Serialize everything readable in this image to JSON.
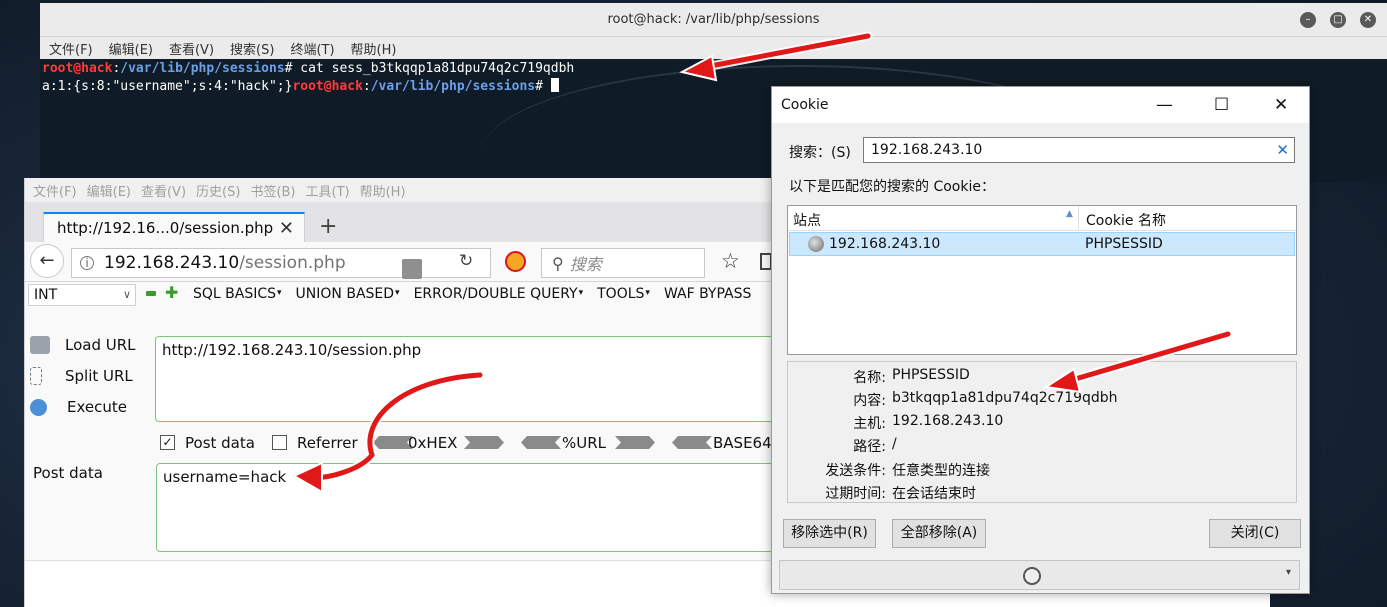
{
  "terminal": {
    "title": "root@hack: /var/lib/php/sessions",
    "menu": [
      "文件(F)",
      "编辑(E)",
      "查看(V)",
      "搜索(S)",
      "终端(T)",
      "帮助(H)"
    ],
    "line1": {
      "user": "root@hack",
      "sep": ":",
      "path": "/var/lib/php/sessions",
      "cmd": "# cat sess_b3tkqqp1a81dpu74q2c719qdbh"
    },
    "line2": {
      "output": "a:1:{s:8:\"username\";s:4:\"hack\";}",
      "user": "root@hack",
      "sep": ":",
      "path": "/var/lib/php/sessions",
      "prompt": "# "
    }
  },
  "firefox": {
    "menu": [
      "文件(F)",
      "编辑(E)",
      "查看(V)",
      "历史(S)",
      "书签(B)",
      "工具(T)",
      "帮助(H)"
    ],
    "tab_title": "http://192.16...0/session.php",
    "url_host": "192.168.243.10",
    "url_path": "/session.php",
    "search_placeholder": "搜索"
  },
  "hackbar": {
    "select_value": "INT",
    "menus": [
      "SQL BASICS",
      "UNION BASED",
      "ERROR/DOUBLE QUERY",
      "TOOLS",
      "WAF BYPASS"
    ],
    "load_url": "Load URL",
    "split_url": "Split URL",
    "execute": "Execute",
    "url_value": "http://192.168.243.10/session.php",
    "post_data_checked": true,
    "post_data_label": "Post data",
    "referrer_checked": false,
    "referrer_label": "Referrer",
    "hex_label": "0xHEX",
    "url_enc_label": "%URL",
    "base64_label": "BASE64",
    "post_section_label": "Post data",
    "post_value": "username=hack"
  },
  "cookie_dialog": {
    "title": "Cookie",
    "search_label": "搜索：(S)",
    "search_value": "192.168.243.10",
    "match_label": "以下是匹配您的搜索的 Cookie：",
    "col_site": "站点",
    "col_name": "Cookie 名称",
    "row_site": "192.168.243.10",
    "row_name": "PHPSESSID",
    "details": [
      {
        "label": "名称:",
        "value": "PHPSESSID"
      },
      {
        "label": "内容:",
        "value": "b3tkqqp1a81dpu74q2c719qdbh"
      },
      {
        "label": "主机:",
        "value": "192.168.243.10"
      },
      {
        "label": "路径:",
        "value": "/"
      },
      {
        "label": "发送条件:",
        "value": "任意类型的连接"
      },
      {
        "label": "过期时间:",
        "value": "在会话结束时"
      }
    ],
    "btn_remove_selected": "移除选中(R)",
    "btn_remove_all": "全部移除(A)",
    "btn_close": "关闭(C)"
  },
  "colors": {
    "annotation_arrow": "#e01818",
    "prompt_user": "#ff3b3b",
    "prompt_path": "#6d9fe8",
    "hackbar_green": "#3a9b2a"
  }
}
